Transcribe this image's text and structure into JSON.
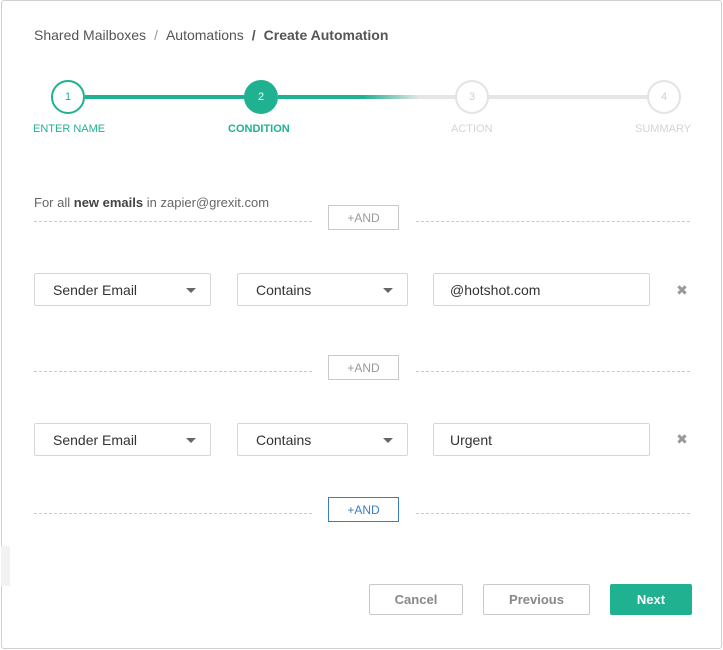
{
  "breadcrumb": {
    "items": [
      "Shared Mailboxes",
      "Automations",
      "Create Automation"
    ],
    "separator": "/"
  },
  "stepper": {
    "steps": [
      {
        "number": "1",
        "label": "ENTER NAME",
        "state": "done"
      },
      {
        "number": "2",
        "label": "CONDITION",
        "state": "active"
      },
      {
        "number": "3",
        "label": "ACTION",
        "state": "pending"
      },
      {
        "number": "4",
        "label": "SUMMARY",
        "state": "pending"
      }
    ],
    "colors": {
      "accent": "#20b190",
      "inactive": "#e0e0e0",
      "label_inactive": "#d0d0d0"
    }
  },
  "intro": {
    "prefix": "For all",
    "emphasis": "new emails",
    "middle": "in",
    "mailbox": "zapier@grexit.com"
  },
  "and_label": "+AND",
  "conditions": [
    {
      "field": "Sender Email",
      "operator": "Contains",
      "value": "@hotshot.com"
    },
    {
      "field": "Sender Email",
      "operator": "Contains",
      "value": "Urgent"
    }
  ],
  "footer": {
    "cancel": "Cancel",
    "previous": "Previous",
    "next": "Next"
  },
  "colors": {
    "primary": "#20b190",
    "and_active": "#3b7dc4"
  }
}
